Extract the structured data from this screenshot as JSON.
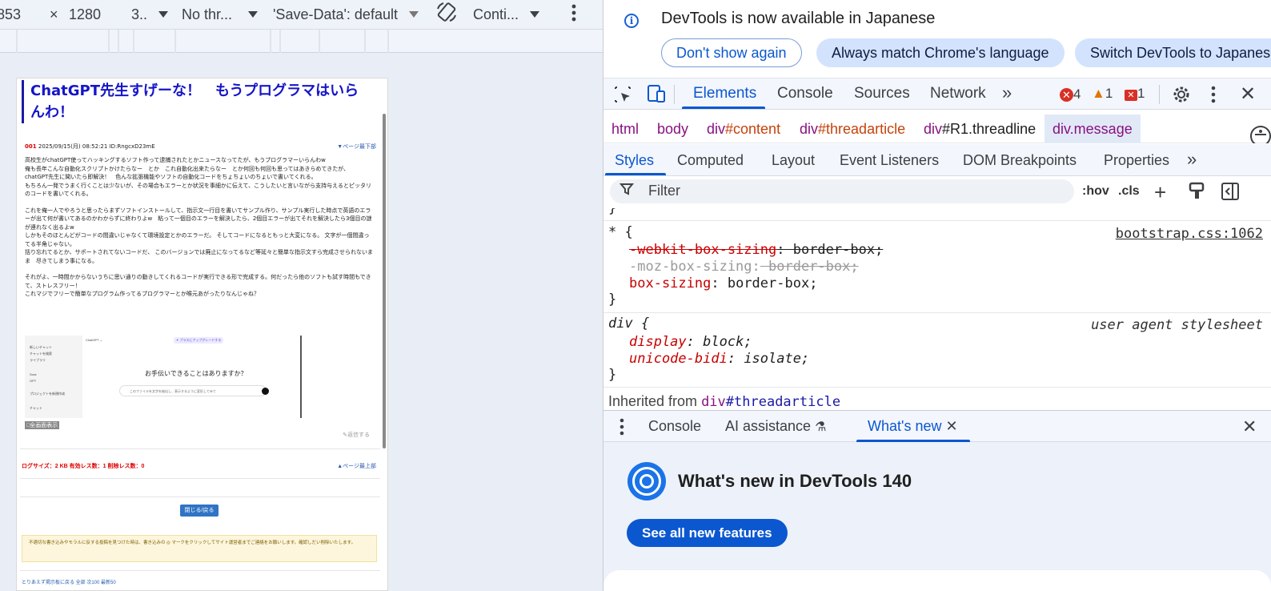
{
  "device_toolbar": {
    "width_value": "853",
    "times": "×",
    "height_value": "1280",
    "zoom": "3..",
    "throttle": "No thr...",
    "save_data": "'Save-Data': default",
    "more_dropdown": "Conti..."
  },
  "page": {
    "title": "ChatGPT先生すげーな！　もうプログラマはいらんわ！",
    "post_number": "001",
    "post_meta": "2025/09/15(月) 08:52:21 ID:RngcxD23mE",
    "page_bottom_link": "▼ページ最下部",
    "paragraphs": [
      "高校生がchatGPT使ってハッキングするソフト作って逮捕されたとかニュースなってたが、もうプログラマーいらんわw\n俺も長年こんな自動化スクリプトかけたらなー　とか　これ自動化出来たらなー　とか何回も何回も思ってはあきらめてきたが、\nchatGPT先生に聞いたら即解決！　色んな拡張機能やソフトの自動化コードをちょちょいのちょいで書いてくれる。\nもちろん一発でうまく行くことは少ないが、その場合もエラーとか状況を事細かに伝えて、こうしたいと言いながら支持与えるとピッタリのコードを書いてくれる。",
      "これを俺一人でやろうと思ったらまずソフトインストールして、指示文一行目を書いてサンプル作り、サンプル実行した時点で英語のエラーが出て何が書いてあるのかわからずに終わりよw　粘って一個目のエラーを解決したら、2個目エラーが出てそれを解決したら3個目の謎が連れなく出るよw\nしかもそのほとんどがコードの間違いじゃなくて環境設定とかのエラーだ。 そしてコードになるともっと大変になる。 文字が一個間違ってる半角じゃない。\n括り忘れてるとか、サポートされてないコードだ、 このバージョンでは廃止になってるなど等延々と簡単な指示文すら完成させられないまま　尽きてしまう事になる。",
      "それがよ、一時間かからないうちに思い通りの動きしてくれるコードが実行できる形で完成する。何だったら他のソフトも試す時間もできて、ストレスフリー！\nこれマジでフリーで簡単なプログラム作ってるプログラマーとか喉元あがったりなんじゃね？"
    ],
    "screenshot": {
      "brand": "ChatGPT ⌄",
      "upgrade": "✦ プラスにアップグレードする",
      "sidebar_items": [
        "新しいチャット",
        "チャットを検索",
        "ライブラリ",
        "Sora",
        "GPT",
        "プロジェクトを新規作成",
        "チャット"
      ],
      "question": "お手伝いできることはありますか？",
      "composer_placeholder": "このファイルを文字を抽出し、表示するように変形してみて"
    },
    "expand_badge": "□全画面表示",
    "reply_link": "✎返信する",
    "log_size": "ログサイズ：2 KB 有効レス数：1 削除レス数：0",
    "page_top_link": "▲ページ最上部",
    "close_button": "閉じる/戻る",
    "notice": "不適切な書き込みやモラルに反する投稿を見つけた時は、書き込みの ◎ マークをクリックしてサイト運営者までご連絡をお願いします。確認しだい削除いたします。",
    "footer_link": "とりあえず掲示板に戻る 全部 次100 最新50"
  },
  "devtools": {
    "infobar": {
      "message": "DevTools is now available in Japanese",
      "dont_show": "Don't show again",
      "match_language": "Always match Chrome's language",
      "switch": "Switch DevTools to Japanese"
    },
    "main_tabs": [
      "Elements",
      "Console",
      "Sources",
      "Network"
    ],
    "more_tabs": "»",
    "errors": "4",
    "warnings": "1",
    "issues": "1",
    "breadcrumbs": {
      "html": "html",
      "body": "body",
      "content_tag": "div",
      "content_rest": "#content",
      "thread_tag": "div",
      "thread_rest": "#threadarticle",
      "r1_tag": "div",
      "r1_rest": "#R1.threadline",
      "message": "div.message"
    },
    "style_tabs": [
      "Styles",
      "Computed",
      "Layout",
      "Event Listeners",
      "DOM Breakpoints",
      "Properties"
    ],
    "filter_placeholder": "Filter",
    "filter_hov": ":hov",
    "filter_cls": ".cls",
    "rules": {
      "prev_close": "}",
      "r1_selector": "* {",
      "r1_source": "bootstrap.css:1062",
      "r1_p1_name": "-webkit-box-sizing",
      "r1_p1_value": " border-box;",
      "r1_p2_name": "-moz-box-sizing",
      "r1_p2_value": " border-box;",
      "r1_p3_name": "box-sizing",
      "r1_p3_value": " border-box;",
      "r1_close": "}",
      "r2_selector": "div {",
      "r2_source": "user agent stylesheet",
      "r2_p1_name": "display",
      "r2_p1_value": " block;",
      "r2_p2_name": "unicode-bidi",
      "r2_p2_value": " isolate;",
      "r2_close": "}",
      "colon": ":"
    },
    "inherited_label": "Inherited from ",
    "inherited_tag": "div",
    "inherited_rest": "#threadarticle",
    "drawer_tabs": [
      "Console",
      "AI assistance",
      "What's new"
    ],
    "whats_new_title": "What's new in DevTools 140",
    "see_all": "See all new features"
  },
  "colors": {
    "accent": "#0b57d0",
    "error": "#d93025",
    "warning": "#e37400",
    "page_title": "#1515c8"
  }
}
